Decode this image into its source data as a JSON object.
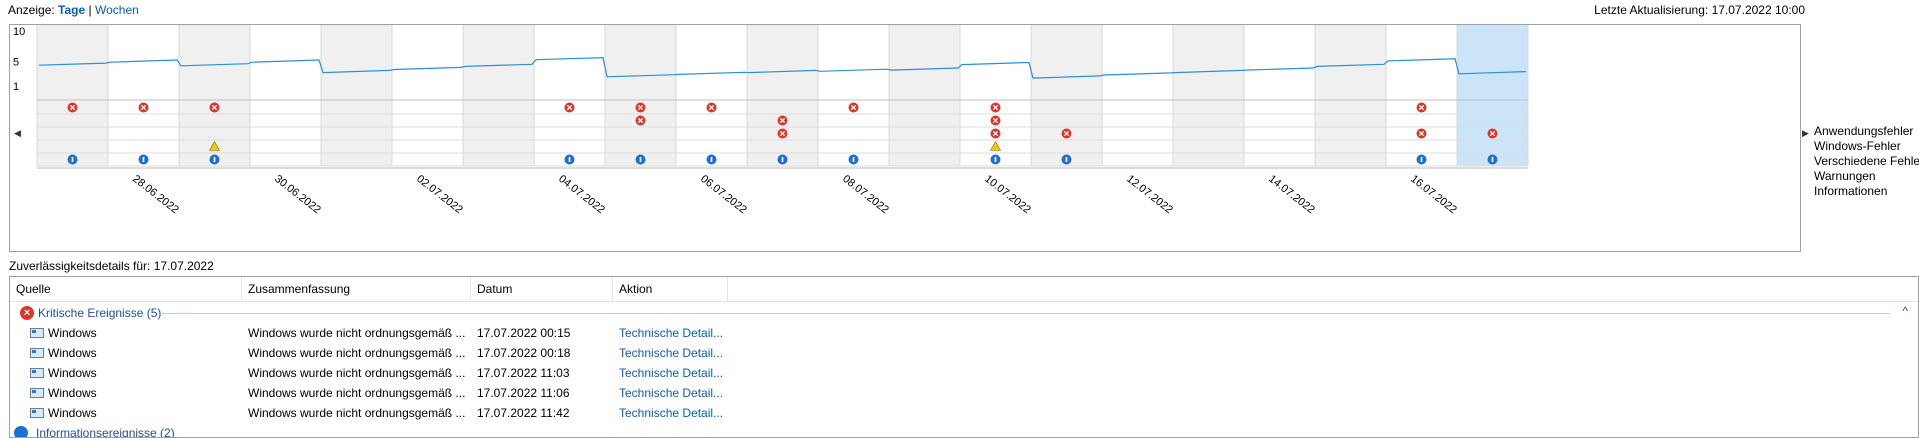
{
  "view": {
    "prefix": "Anzeige:",
    "days": "Tage",
    "sep": "|",
    "weeks": "Wochen"
  },
  "last_update": "Letzte Aktualisierung: 17.07.2022 10:00",
  "chart_data": {
    "type": "line",
    "y_ticks": [
      "10",
      "5",
      "1"
    ],
    "ylim": [
      1,
      10
    ],
    "date_labels": [
      "28.06.2022",
      "30.06.2022",
      "02.07.2022",
      "04.07.2022",
      "06.07.2022",
      "08.07.2022",
      "10.07.2022",
      "12.07.2022",
      "14.07.2022",
      "16.07.2022"
    ],
    "days": [
      "27.06",
      "28.06",
      "29.06",
      "30.06",
      "01.07",
      "02.07",
      "03.07",
      "04.07",
      "05.07",
      "06.07",
      "07.07",
      "08.07",
      "09.07",
      "10.07",
      "11.07",
      "12.07",
      "13.07",
      "14.07",
      "15.07",
      "16.07",
      "17.07"
    ],
    "stability_index": [
      4.4,
      4.9,
      4.3,
      4.9,
      3.2,
      3.7,
      4.2,
      5.3,
      2.5,
      2.9,
      3.2,
      3.4,
      3.6,
      4.5,
      2.3,
      2.8,
      3.2,
      3.6,
      4.2,
      5.1,
      3.0
    ],
    "event_rows": [
      "Anwendungsfehler",
      "Windows-Fehler",
      "Verschiedene Fehler",
      "Warnungen",
      "Informationen"
    ],
    "events": {
      "Anwendungsfehler": [
        0,
        1,
        2,
        7,
        8,
        9,
        11,
        13,
        19
      ],
      "Windows-Fehler": [
        8,
        10,
        13
      ],
      "Verschiedene Fehler": [
        10,
        13,
        14,
        19,
        20
      ],
      "Warnungen": [
        2,
        13
      ],
      "Informationen": [
        0,
        1,
        2,
        7,
        8,
        9,
        10,
        11,
        13,
        14,
        19,
        20
      ]
    },
    "selected_day": "17.07",
    "colors": {
      "line": "#2b8fd9",
      "shade": "#f0f0f0",
      "selected": "#cce4f7",
      "error": "#d9372a",
      "info": "#1f6fd1",
      "warning": "#f5c518"
    }
  },
  "legend": [
    "Anwendungsfehler",
    "Windows-Fehler",
    "Verschiedene Fehler",
    "Warnungen",
    "Informationen"
  ],
  "details_title": "Zuverlässigkeitsdetails für: 17.07.2022",
  "columns": [
    "Quelle",
    "Zusammenfassung",
    "Datum",
    "Aktion"
  ],
  "group": {
    "label": "Kritische Ereignisse (5)"
  },
  "rows": [
    {
      "source": "Windows",
      "summary": "Windows wurde nicht ordnungsgemäß ...",
      "date": "17.07.2022 00:15",
      "action": "Technische Detail..."
    },
    {
      "source": "Windows",
      "summary": "Windows wurde nicht ordnungsgemäß ...",
      "date": "17.07.2022 00:18",
      "action": "Technische Detail..."
    },
    {
      "source": "Windows",
      "summary": "Windows wurde nicht ordnungsgemäß ...",
      "date": "17.07.2022 11:03",
      "action": "Technische Detail..."
    },
    {
      "source": "Windows",
      "summary": "Windows wurde nicht ordnungsgemäß ...",
      "date": "17.07.2022 11:06",
      "action": "Technische Detail..."
    },
    {
      "source": "Windows",
      "summary": "Windows wurde nicht ordnungsgemäß ...",
      "date": "17.07.2022 11:42",
      "action": "Technische Detail..."
    }
  ],
  "group2": {
    "label": "Informationsereignisse (2)"
  }
}
